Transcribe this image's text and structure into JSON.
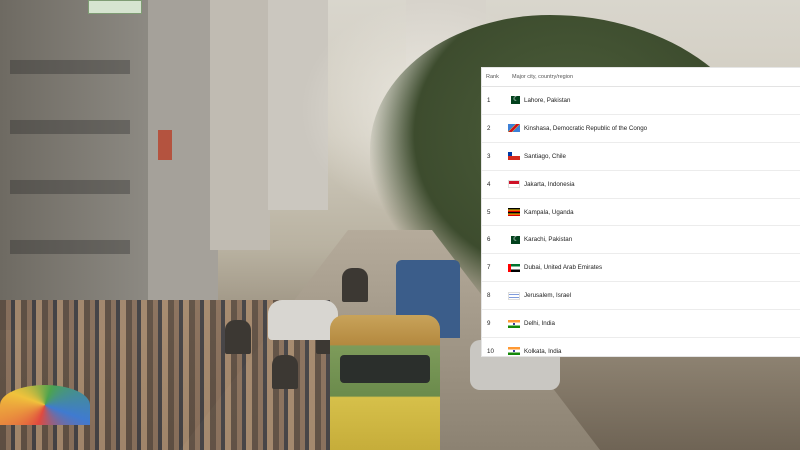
{
  "table": {
    "headers": {
      "rank": "Rank",
      "city": "Major city, country/region"
    },
    "rows": [
      {
        "rank": "1",
        "city": "Lahore, Pakistan",
        "flag_icon": "pakistan-flag-icon"
      },
      {
        "rank": "2",
        "city": "Kinshasa, Democratic Republic of the Congo",
        "flag_icon": "dr-congo-flag-icon"
      },
      {
        "rank": "3",
        "city": "Santiago, Chile",
        "flag_icon": "chile-flag-icon"
      },
      {
        "rank": "4",
        "city": "Jakarta, Indonesia",
        "flag_icon": "indonesia-flag-icon"
      },
      {
        "rank": "5",
        "city": "Kampala, Uganda",
        "flag_icon": "uganda-flag-icon"
      },
      {
        "rank": "6",
        "city": "Karachi, Pakistan",
        "flag_icon": "pakistan-flag-icon"
      },
      {
        "rank": "7",
        "city": "Dubai, United Arab Emirates",
        "flag_icon": "uae-flag-icon"
      },
      {
        "rank": "8",
        "city": "Jerusalem, Israel",
        "flag_icon": "israel-flag-icon"
      },
      {
        "rank": "9",
        "city": "Delhi, India",
        "flag_icon": "india-flag-icon"
      },
      {
        "rank": "10",
        "city": "Kolkata, India",
        "flag_icon": "india-flag-icon"
      }
    ]
  },
  "colors": {
    "table_bg": "#ffffff",
    "row_divider": "#ececec",
    "text": "#222222"
  }
}
